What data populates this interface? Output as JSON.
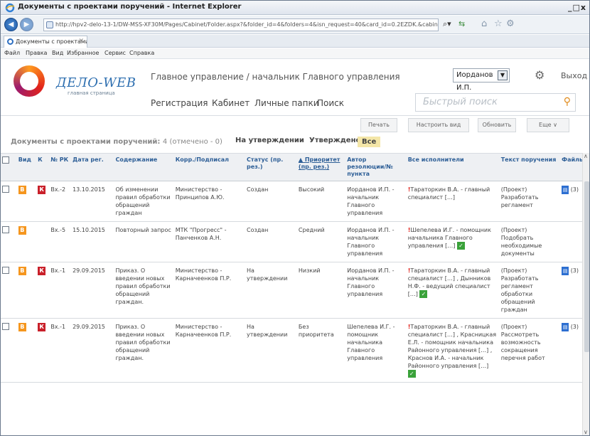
{
  "window": {
    "title": "Документы с проектами поручений - Internet Explorer",
    "controls": "_□x"
  },
  "browser": {
    "url": "http://hpv2-delo-13-1/DW-MSS-XF30M/Pages/Cabinet/Folder.aspx?&folder_id=4&folders=4&isn_request=40&card_id=0.2EZDK.&cabinet_id=4058328",
    "tab_label": "Документы с проектами по...",
    "menu": [
      "Файл",
      "Правка",
      "Вид",
      "Избранное",
      "Сервис",
      "Справка"
    ]
  },
  "app": {
    "brand": "ДЕЛО-WEB",
    "brand_sub": "главная страница",
    "breadcrumb": "Главное управление / начальник Главного управления",
    "user": "Иорданов И.П.",
    "exit": "Выход",
    "nav": [
      "Регистрация",
      "Кабинет",
      "Личные папки",
      "Поиск"
    ],
    "search_placeholder": "Быстрый поиск"
  },
  "toolbar": {
    "print": "Печать",
    "configure": "Настроить вид",
    "refresh": "Обновить",
    "more": "Еще ∨"
  },
  "list": {
    "title": "Документы с проектами поручений:",
    "count": "4 (отмечено - 0)",
    "filters": [
      "На утверждении",
      "Утверждено",
      "Все"
    ],
    "active_filter": "Все"
  },
  "columns": [
    "Вид",
    "К",
    "№ РК",
    "Дата рег.",
    "Содержание",
    "Корр./Подписал",
    "Статус (пр. рез.)",
    "▲ Приоритет (пр. рез.)",
    "Автор резолюции/№ пункта",
    "Все исполнители",
    "Текст поручения",
    "Файлы"
  ],
  "rows": [
    {
      "b": "В",
      "k": "К",
      "num": "Вх.-2",
      "date": "13.10.2015",
      "content": "Об изменении правил обработки обращений граждан",
      "corr": "Министерство - Принципов А.Ю.",
      "status": "Создан",
      "priority": "Высокий",
      "author": "Иорданов И.П. - начальник Главного управления",
      "executors_mark": "!",
      "executors": "Тараторкин В.А. - главный специалист […]",
      "text": "(Проект) Разработать регламент",
      "files": "(3)"
    },
    {
      "b": "В",
      "k": "",
      "num": "Вх.-5",
      "date": "15.10.2015",
      "content": "Повторный запрос",
      "corr": "МТК \"Прогресс\" - Панченков А.Н.",
      "status": "Создан",
      "priority": "Средний",
      "author": "Иорданов И.П. - начальник Главного управления",
      "executors_mark": "!",
      "executors": "Шепелева И.Г. - помощник начальника Главного управления […]",
      "text": "(Проект) Подобрать необходимые документы",
      "files": ""
    },
    {
      "b": "В",
      "k": "К",
      "num": "Вх.-1",
      "date": "29.09.2015",
      "content": "Приказ. О введении новых правил обработки обращений граждан.",
      "corr": "Министерство - Карначеенков П.Р.",
      "status": "На утверждении",
      "priority": "Низкий",
      "author": "Иорданов И.П. - начальник Главного управления",
      "executors_mark": "!",
      "executors": "Тараторкин В.А. - главный специалист […] , Дынников Н.Ф. - ведущий специалист […]",
      "text": "(Проект) Разработать регламент обработки обращений граждан",
      "files": "(3)"
    },
    {
      "b": "В",
      "k": "К",
      "num": "Вх.-1",
      "date": "29.09.2015",
      "content": "Приказ. О введении новых правил обработки обращений граждан.",
      "corr": "Министерство - Карначеенков П.Р.",
      "status": "На утверждении",
      "priority": "Без приоритета",
      "author": "Шепелева И.Г. - помощник начальника Главного управления",
      "executors_mark": "!",
      "executors": "Тараторкин В.А. - главный специалист […] , Красницкая Е.Л. - помощник начальника Районного управления […] , Краснов И.А. - начальник Районного управления […]",
      "text": "(Проект) Рассмотреть возможность сокращения перечня работ",
      "files": "(3)"
    }
  ]
}
